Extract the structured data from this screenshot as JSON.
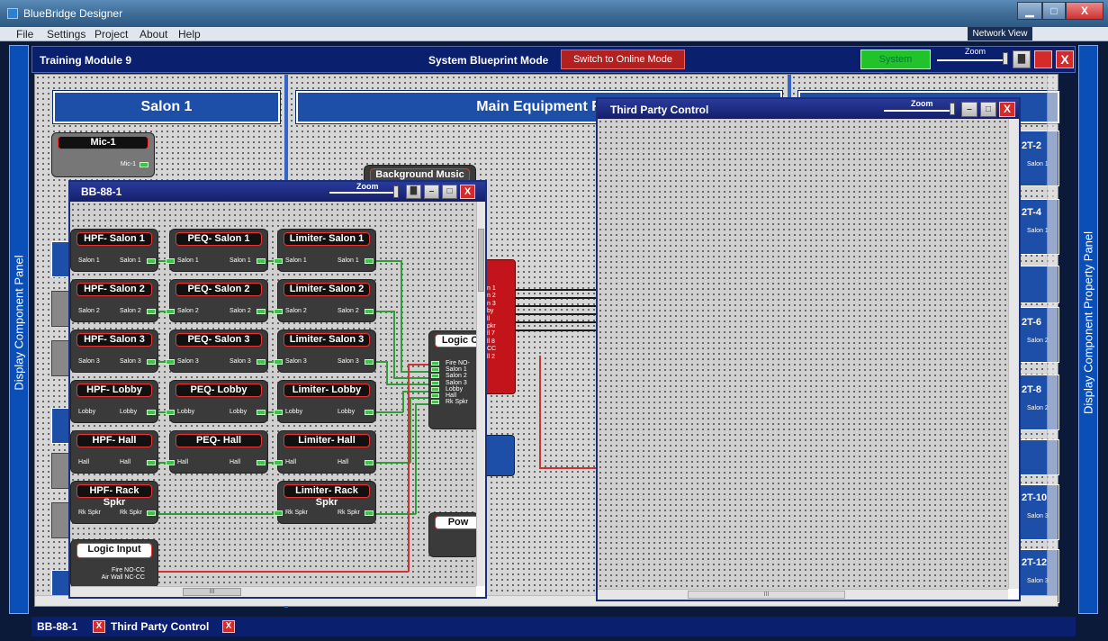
{
  "window": {
    "title": "BlueBridge Designer",
    "btn_min": "▁",
    "btn_max": "□",
    "btn_close": "X"
  },
  "menu": [
    "File",
    "Settings",
    "Project",
    "About",
    "Help"
  ],
  "network_view_label": "Network View",
  "toolbar": {
    "module": "Training Module 9",
    "mode": "System Blueprint Mode",
    "online_button": "Switch to Online Mode",
    "presets_button": "System Presets",
    "zoom_label": "Zoom"
  },
  "left_panel_label": "Display Component Panel",
  "right_panel_label": "Display Component Property Panel",
  "canvas": {
    "rooms": [
      "Salon 1",
      "Main Equipment R"
    ],
    "mic_block": {
      "title": "Mic-1",
      "port": "Mic-1"
    },
    "bg_music_block": {
      "title": "Background Music"
    },
    "right_cards": [
      {
        "title": "2T-2",
        "sub": "Salon 1"
      },
      {
        "title": "2T-4",
        "sub": "Salon 1"
      },
      {
        "title": "2T-6",
        "sub": "Salon 2"
      },
      {
        "title": "2T-8",
        "sub": "Salon 2"
      },
      {
        "title": "2T-10",
        "sub": "Salon 3"
      },
      {
        "title": "2T-12",
        "sub": "Salon 3"
      }
    ],
    "red_block_labels": [
      "n 1",
      "n 2",
      "n 3",
      "by",
      "ll",
      "pkr",
      "ll 7",
      "ll 8",
      "CC",
      "ll 2"
    ],
    "pow_block": "Pow"
  },
  "bb_window": {
    "title": "BB-88-1",
    "zoom_label": "Zoom",
    "hpf": [
      {
        "title": "HPF- Salon 1",
        "in": "Salon 1",
        "out": "Salon 1"
      },
      {
        "title": "HPF- Salon 2",
        "in": "Salon 2",
        "out": "Salon 2"
      },
      {
        "title": "HPF- Salon 3",
        "in": "Salon 3",
        "out": "Salon 3"
      },
      {
        "title": "HPF- Lobby",
        "in": "Lobby",
        "out": "Lobby"
      },
      {
        "title": "HPF- Hall",
        "in": "Hall",
        "out": "Hall"
      },
      {
        "title": "HPF- Rack Spkr",
        "in": "Rk Spkr",
        "out": "Rk Spkr"
      }
    ],
    "peq": [
      {
        "title": "PEQ- Salon 1",
        "in": "Salon 1",
        "out": "Salon 1"
      },
      {
        "title": "PEQ- Salon 2",
        "in": "Salon 2",
        "out": "Salon 2"
      },
      {
        "title": "PEQ- Salon 3",
        "in": "Salon 3",
        "out": "Salon 3"
      },
      {
        "title": "PEQ- Lobby",
        "in": "Lobby",
        "out": "Lobby"
      },
      {
        "title": "PEQ- Hall",
        "in": "Hall",
        "out": "Hall"
      }
    ],
    "limiter": [
      {
        "title": "Limiter- Salon 1",
        "in": "Salon 1",
        "out": "Salon 1"
      },
      {
        "title": "Limiter- Salon 2",
        "in": "Salon 2",
        "out": "Salon 2"
      },
      {
        "title": "Limiter- Salon 3",
        "in": "Salon 3",
        "out": "Salon 3"
      },
      {
        "title": "Limiter- Lobby",
        "in": "Lobby",
        "out": "Lobby"
      },
      {
        "title": "Limiter- Hall",
        "in": "Hall",
        "out": "Hall"
      },
      {
        "title": "Limiter- Rack Spkr",
        "in": "Rk Spkr",
        "out": "Rk Spkr"
      }
    ],
    "logic_out": {
      "title": "Logic C",
      "ports": [
        "Fire NO-",
        "Salon 1",
        "Salon 2",
        "Salon 3",
        "Lobby",
        "Hall",
        "Rk Spkr"
      ]
    },
    "logic_input": {
      "title": "Logic Input",
      "ports": [
        "Fire NO-CC",
        "Air Wall NC-CC"
      ]
    },
    "pow": "Pow",
    "hscroll_thumb": "III"
  },
  "third_party": {
    "title": "Third Party Control",
    "zoom_label": "Zoom",
    "hscroll_thumb": "III"
  },
  "bottom_tabs": [
    {
      "label": "BB-88-1"
    },
    {
      "label": "Third Party Control"
    }
  ],
  "bottom_close": "X"
}
